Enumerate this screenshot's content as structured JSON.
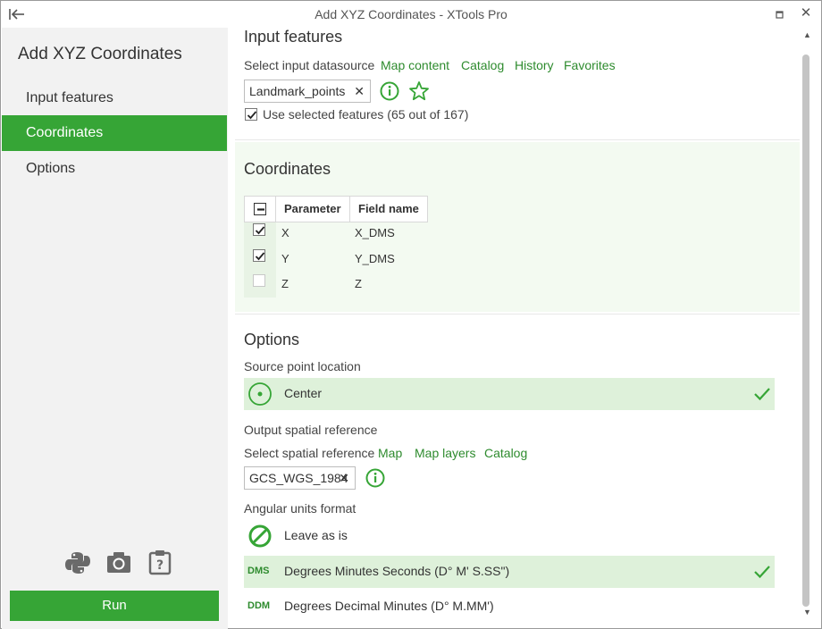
{
  "window": {
    "title": "Add XYZ Coordinates - XTools Pro"
  },
  "sidebar": {
    "heading": "Add XYZ Coordinates",
    "items": [
      {
        "label": "Input features"
      },
      {
        "label": "Coordinates"
      },
      {
        "label": "Options"
      }
    ],
    "active_index": 1,
    "tools": [
      "python-icon",
      "camera-icon",
      "help-icon"
    ],
    "run_label": "Run"
  },
  "input_features": {
    "title": "Input features",
    "datasource_label": "Select input datasource",
    "links": [
      "Map content",
      "Catalog",
      "History",
      "Favorites"
    ],
    "selected_layer": "Landmark_points",
    "use_selected_label": "Use selected features (65 out of 167)",
    "use_selected_checked": true
  },
  "coordinates": {
    "title": "Coordinates",
    "columns": [
      "Parameter",
      "Field name"
    ],
    "rows": [
      {
        "parameter": "X",
        "field": "X_DMS",
        "checked": true
      },
      {
        "parameter": "Y",
        "field": "Y_DMS",
        "checked": true
      },
      {
        "parameter": "Z",
        "field": "Z",
        "checked": false
      }
    ]
  },
  "options": {
    "title": "Options",
    "source_point_label": "Source point location",
    "source_point_value": "Center",
    "spatial_ref_label": "Output spatial reference",
    "select_sr_label": "Select spatial reference",
    "sr_links": [
      "Map",
      "Map layers",
      "Catalog"
    ],
    "selected_sr": "GCS_WGS_1984",
    "angular_label": "Angular units format",
    "angular_options": [
      {
        "abbr": "",
        "label": "Leave as is",
        "selected": false
      },
      {
        "abbr": "DMS",
        "label": "Degrees Minutes Seconds (D° M' S.SS\")",
        "selected": true
      },
      {
        "abbr": "DDM",
        "label": "Degrees Decimal Minutes (D° M.MM')",
        "selected": false
      }
    ]
  },
  "colors": {
    "accent": "#36a536",
    "link": "#2e8b2e",
    "highlight": "#def1da"
  }
}
